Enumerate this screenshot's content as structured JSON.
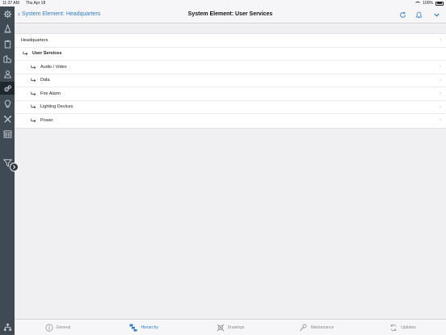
{
  "status_bar": {
    "time": "11:37 AM",
    "date": "Thu Apr 18",
    "battery": "100%"
  },
  "nav": {
    "back_label": "System Element: Headquarters",
    "title": "System Element: User Services"
  },
  "hierarchy": {
    "parent": "Headquarters",
    "current": "User Services",
    "children": [
      "Audio / Video",
      "Data",
      "Fire Alarm",
      "Lighting Devices",
      "Power"
    ]
  },
  "tabs": [
    {
      "label": "General",
      "icon": "info-icon",
      "active": false
    },
    {
      "label": "Hierarchy",
      "icon": "hierarchy-icon",
      "active": true
    },
    {
      "label": "Drawings",
      "icon": "drawings-icon",
      "active": false
    },
    {
      "label": "Maintenance",
      "icon": "wrench-icon",
      "active": false
    },
    {
      "label": "Updates",
      "icon": "sync-icon",
      "active": false
    }
  ],
  "colors": {
    "accent": "#2f7fd0",
    "sidebar": "#3f4a55",
    "sidebar_active": "#1f2830"
  }
}
